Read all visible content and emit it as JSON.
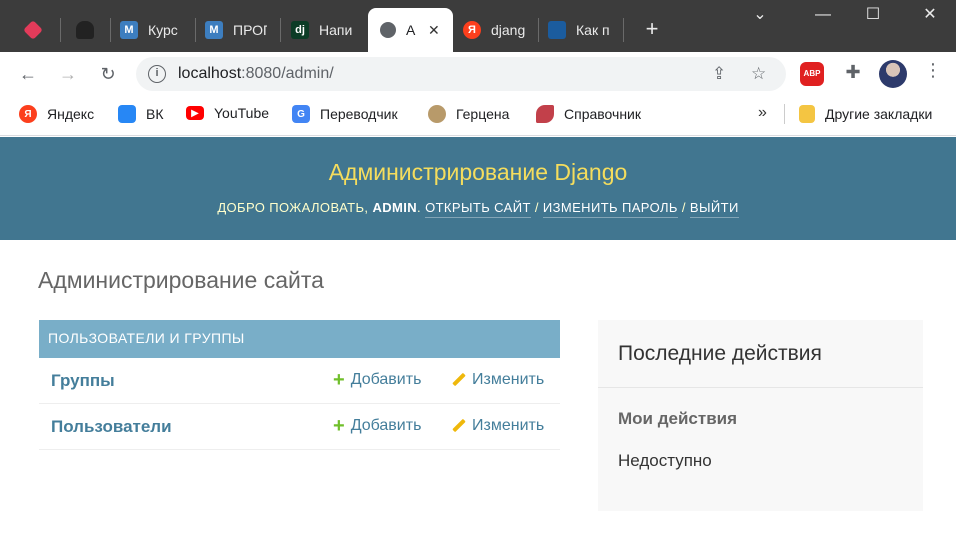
{
  "browser": {
    "tabs": [
      {
        "title": "",
        "icon": "dice-icon",
        "color": "#e33b5a"
      },
      {
        "title": "",
        "icon": "cat-icon",
        "color": "#222222"
      },
      {
        "title": "Курс",
        "icon": "m-icon",
        "color": "#3d7ebf",
        "glyph": "M"
      },
      {
        "title": "ПРОГ",
        "icon": "m-icon",
        "color": "#3d7ebf",
        "glyph": "M"
      },
      {
        "title": "Напи",
        "icon": "django-icon",
        "color": "#0c3c26",
        "glyph": "dj"
      },
      {
        "title": "А",
        "icon": "globe-icon",
        "color": "#5f6368",
        "active": true
      },
      {
        "title": "djang",
        "icon": "yandex-icon",
        "color": "#fc3f1d",
        "glyph": "Я"
      },
      {
        "title": "Как п",
        "icon": "stackoverflow-icon",
        "color": "#1b5c9e"
      }
    ],
    "address": {
      "host": "localhost",
      "rest": ":8080/admin/"
    },
    "bookmarks": [
      {
        "label": "Яндекс",
        "icon": "yandex-icon",
        "color": "#fc3f1d",
        "glyph": "Я"
      },
      {
        "label": "ВК",
        "icon": "vk-icon",
        "color": "#2787f5"
      },
      {
        "label": "YouTube",
        "icon": "youtube-icon",
        "color": "#ff0000"
      },
      {
        "label": "Переводчик",
        "icon": "google-translate-icon",
        "color": "#4285f4",
        "glyph": "G"
      },
      {
        "label": "Герцена",
        "icon": "seal-icon",
        "color": "#b89a6a"
      },
      {
        "label": "Справочник",
        "icon": "bird-icon",
        "color": "#c2404a"
      }
    ],
    "bookmarks_more": "»",
    "other_bookmarks": "Другие закладки"
  },
  "header": {
    "title": "Администрирование Django",
    "welcome": "ДОБРО ПОЖАЛОВАТЬ,",
    "user": "ADMIN",
    "view_site": "ОТКРЫТЬ САЙТ",
    "change_password": "ИЗМЕНИТЬ ПАРОЛЬ",
    "logout": "ВЫЙТИ",
    "sep": "/"
  },
  "content": {
    "site_title": "Администрирование сайта",
    "module": {
      "caption": "ПОЛЬЗОВАТЕЛИ И ГРУППЫ",
      "rows": [
        {
          "name": "Группы",
          "add": "Добавить",
          "change": "Изменить"
        },
        {
          "name": "Пользователи",
          "add": "Добавить",
          "change": "Изменить"
        }
      ]
    },
    "recent": {
      "title": "Последние действия",
      "subtitle": "Мои действия",
      "empty": "Недоступно"
    }
  }
}
